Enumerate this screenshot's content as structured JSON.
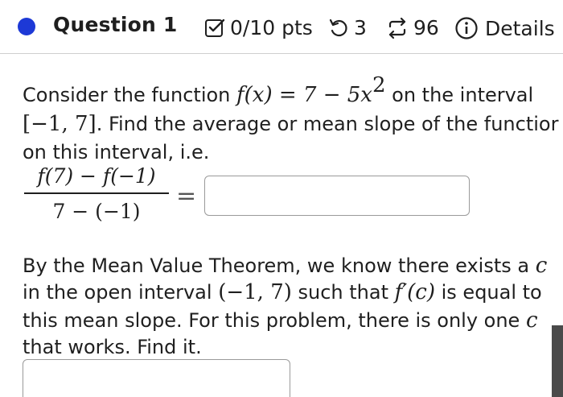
{
  "header": {
    "title": "Question 1",
    "points": "0/10 pts",
    "tries": "3",
    "versions": "96",
    "details": "Details"
  },
  "question": {
    "p1_a": "Consider the function ",
    "p1_func": "f(x) = 7 − 5x",
    "p1_exp": "2",
    "p1_b": " on the interval",
    "p2_interval": "[−1, 7]",
    "p2_b": ". Find the average or mean slope of the functior",
    "p3": "on this interval, i.e.",
    "frac_num": "f(7) − f(−1)",
    "frac_den": "7 − (−1)",
    "equals": "=",
    "p4_a": "By the Mean Value Theorem, we know there exists a ",
    "p4_c": "c",
    "p5_a": "in the open interval ",
    "p5_interval": "(−1, 7)",
    "p5_b": " such that ",
    "p5_deriv": "f′(c)",
    "p5_c": " is equal to",
    "p6_a": "this mean slope. For this problem, there is only one ",
    "p6_c": "c",
    "p7": "that works. Find it."
  },
  "answers": {
    "average_slope": "",
    "c_value": ""
  },
  "colors": {
    "accent_dot": "#1d39d6",
    "border": "#9a9a9a"
  },
  "icons": [
    "checkbox-icon",
    "retry-icon",
    "versions-icon",
    "info-icon"
  ]
}
